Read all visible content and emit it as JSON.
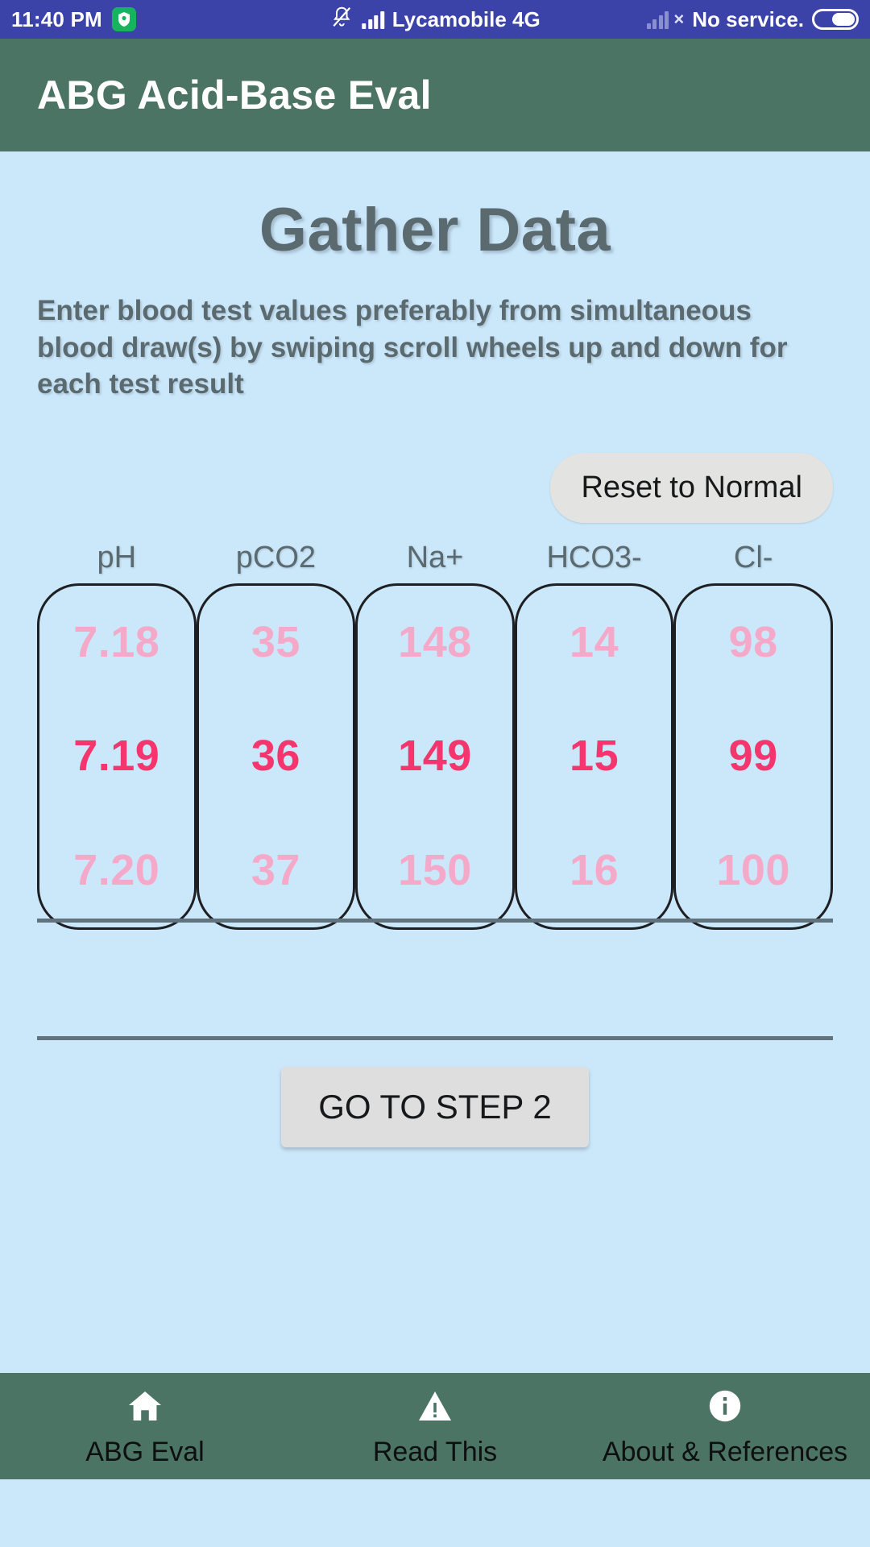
{
  "status_bar": {
    "time": "11:40 PM",
    "badge_icon": "shield-icon",
    "silent_icon": "bell-off-icon",
    "signal_icon": "signal-bars-icon",
    "carrier": "Lycamobile 4G",
    "signal2_icon": "signal-bars-no-service-icon",
    "no_service": "No service.",
    "battery_icon": "battery-icon",
    "bg_color": "#3b43a8"
  },
  "app_bar": {
    "title": "ABG Acid-Base Eval",
    "bg_color": "#4c7465",
    "text_color": "#ffffff"
  },
  "main": {
    "page_title": "Gather Data",
    "instructions": "Enter blood test values preferably from simultaneous blood draw(s) by swiping scroll wheels up and down for each test result",
    "reset_button": "Reset to Normal",
    "step_button": "GO TO STEP 2",
    "bg_color": "#cbe7fa",
    "title_color": "#5a6a6f"
  },
  "wheels": {
    "selected_color": "#f5356d",
    "dim_color": "#f5a9c9",
    "columns": [
      {
        "label": "pH",
        "above": "7.18",
        "selected": "7.19",
        "below": "7.20"
      },
      {
        "label": "pCO2",
        "above": "35",
        "selected": "36",
        "below": "37"
      },
      {
        "label": "Na+",
        "above": "148",
        "selected": "149",
        "below": "150"
      },
      {
        "label": "HCO3-",
        "above": "14",
        "selected": "15",
        "below": "16"
      },
      {
        "label": "Cl-",
        "above": "98",
        "selected": "99",
        "below": "100"
      }
    ]
  },
  "bottom_nav": {
    "bg_color": "#4c7465",
    "items": [
      {
        "label": "ABG Eval",
        "icon": "home-icon"
      },
      {
        "label": "Read This",
        "icon": "warning-triangle-icon"
      },
      {
        "label": "About & References",
        "icon": "info-circle-icon"
      }
    ]
  }
}
